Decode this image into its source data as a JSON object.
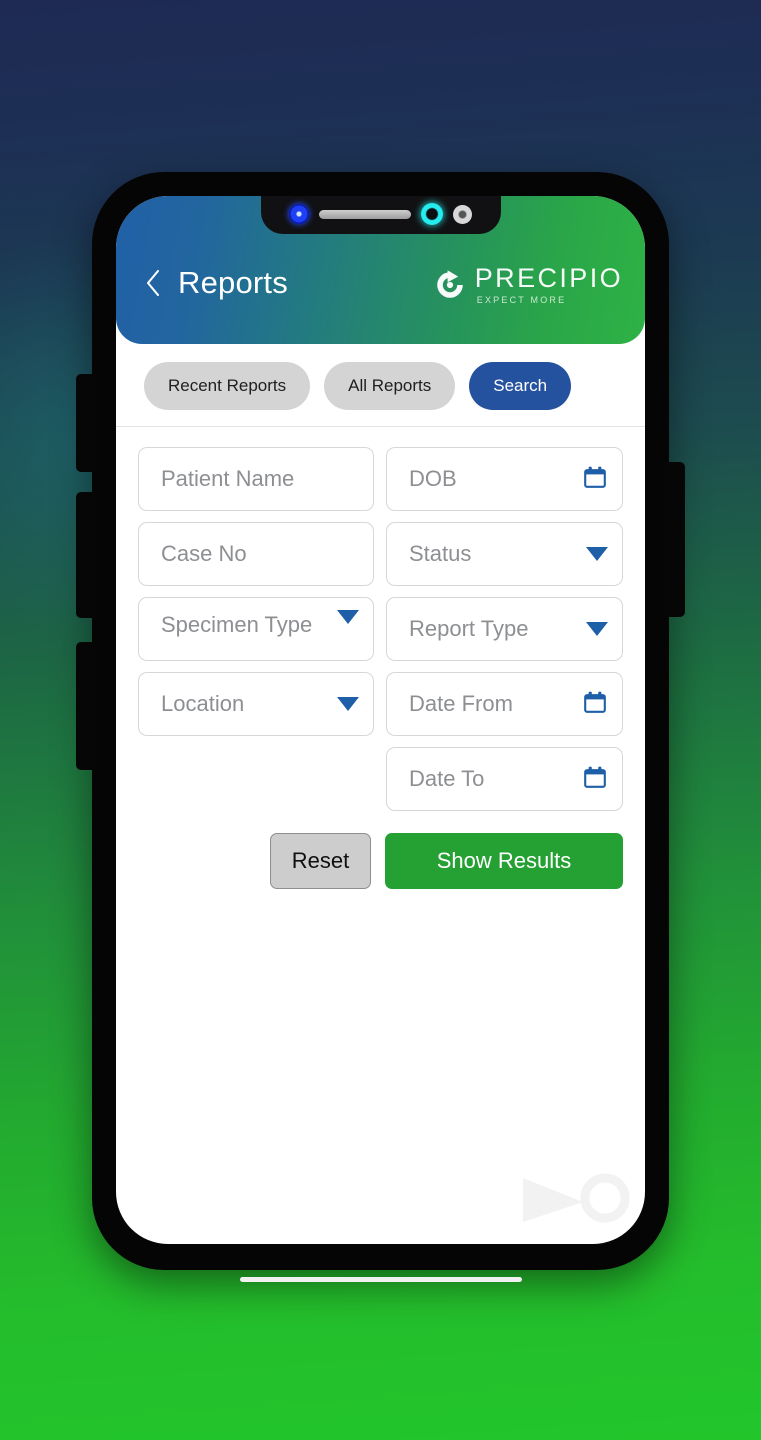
{
  "background": {
    "gradient_top": "#1e2a54",
    "gradient_bottom": "#22c62b"
  },
  "device": {
    "notch": {
      "camera_left": "front-camera-blue",
      "speaker": "earpiece-speaker",
      "camera_center": "front-camera-cyan",
      "camera_right": "front-camera-gray"
    },
    "side_buttons": [
      "silent-switch",
      "volume-up",
      "volume-down",
      "power-button"
    ],
    "home_indicator": "home-indicator"
  },
  "header": {
    "back_icon": "chevron-left-icon",
    "title": "Reports",
    "gradient_start": "#2160a8",
    "gradient_end": "#2eb246",
    "logo": {
      "mark": "precipio-circular-arrow-mark",
      "word": "PRECIPIO",
      "tagline": "EXPECT MORE"
    }
  },
  "tabs": {
    "items": [
      {
        "label": "Recent Reports",
        "active": false
      },
      {
        "label": "All Reports",
        "active": false
      },
      {
        "label": "Search",
        "active": true
      }
    ],
    "active_color": "#25529f",
    "inactive_color": "#d4d4d4"
  },
  "form": {
    "left_column": [
      {
        "label": "Patient Name",
        "type": "text",
        "icon": null,
        "value": ""
      },
      {
        "label": "Case No",
        "type": "text",
        "icon": null,
        "value": ""
      },
      {
        "label": "Specimen Type",
        "type": "select",
        "icon": "chevron-down-icon",
        "value": ""
      },
      {
        "label": "Location",
        "type": "select",
        "icon": "chevron-down-icon",
        "value": ""
      }
    ],
    "right_column": [
      {
        "label": "DOB",
        "type": "date",
        "icon": "calendar-icon",
        "value": ""
      },
      {
        "label": "Status",
        "type": "select",
        "icon": "chevron-down-icon",
        "value": ""
      },
      {
        "label": "Report Type",
        "type": "select",
        "icon": "chevron-down-icon",
        "value": ""
      },
      {
        "label": "Date From",
        "type": "date",
        "icon": "calendar-icon",
        "value": ""
      },
      {
        "label": "Date To",
        "type": "date",
        "icon": "calendar-icon",
        "value": ""
      }
    ],
    "placeholder_color": "#8d8f93",
    "icon_color": "#1f5fa8"
  },
  "actions": {
    "reset_label": "Reset",
    "show_results_label": "Show Results",
    "reset_color": "#cdcdcd",
    "show_results_color": "#25a033"
  }
}
